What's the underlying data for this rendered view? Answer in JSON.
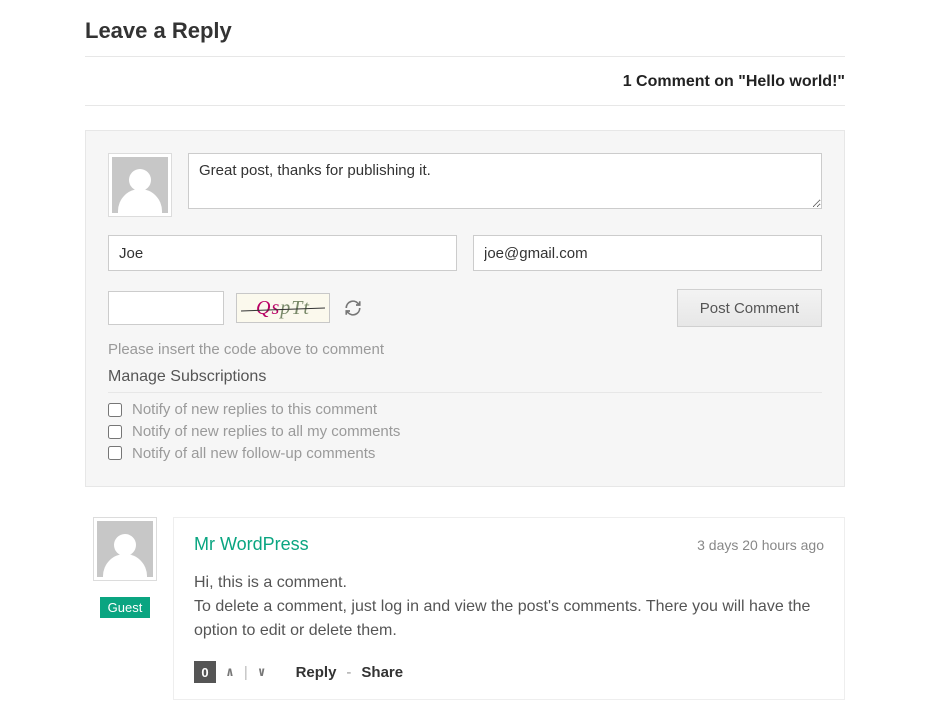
{
  "heading": "Leave a Reply",
  "count_line": "1 Comment on \"Hello world!\"",
  "form": {
    "comment_value": "Great post, thanks for publishing it.",
    "name_value": "Joe",
    "email_value": "joe@gmail.com",
    "captcha_input_value": "",
    "captcha_image_text_part1": "Qs",
    "captcha_image_text_part2": "pTt",
    "post_button": "Post Comment",
    "hint": "Please insert the code above to comment",
    "manage_heading": "Manage Subscriptions",
    "subs": {
      "opt1": "Notify of new replies to this comment",
      "opt2": "Notify of new replies to all my comments",
      "opt3": "Notify of all new follow-up comments"
    }
  },
  "comment": {
    "author": "Mr WordPress",
    "time": "3 days 20 hours ago",
    "line1": "Hi, this is a comment.",
    "line2": "To delete a comment, just log in and view the post's comments. There you will have the option to edit or delete them.",
    "votes": "0",
    "guest_badge": "Guest",
    "reply": "Reply",
    "share": "Share"
  }
}
